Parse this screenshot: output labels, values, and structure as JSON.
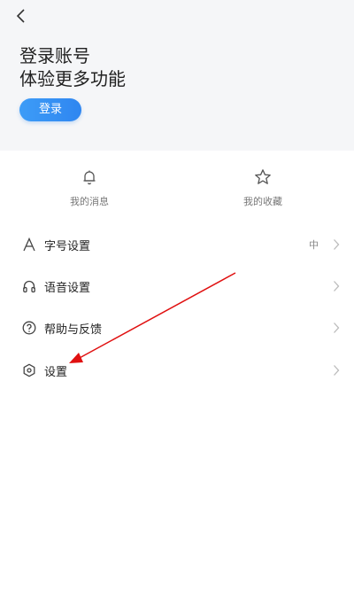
{
  "header": {
    "back_icon": "chevron-left-icon",
    "title": "登录账号",
    "subtitle": "体验更多功能",
    "login_button": "登录",
    "accent_color": "#2f86f0",
    "background": "#f5f6f8"
  },
  "quick_actions": [
    {
      "label": "我的消息",
      "icon": "bell-icon"
    },
    {
      "label": "我的收藏",
      "icon": "star-icon"
    }
  ],
  "menu": [
    {
      "label": "字号设置",
      "value": "中",
      "icon": "font-icon"
    },
    {
      "label": "语音设置",
      "value": "",
      "icon": "headphones-icon"
    },
    {
      "label": "帮助与反馈",
      "value": "",
      "icon": "help-icon"
    },
    {
      "label": "设置",
      "value": "",
      "icon": "settings-icon"
    }
  ],
  "annotation": {
    "color": "#e01010",
    "target": "设置"
  }
}
